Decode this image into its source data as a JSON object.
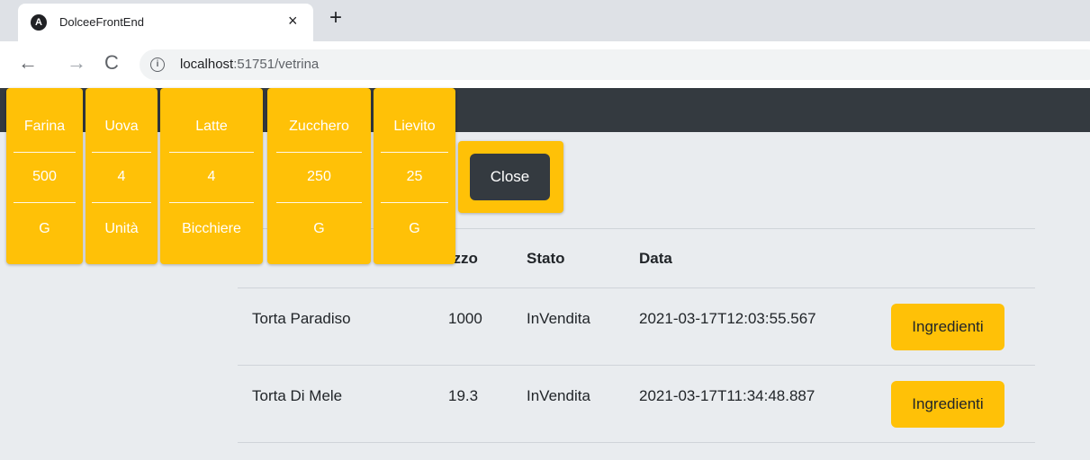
{
  "browser": {
    "tab_title": "DolceeFrontEnd",
    "tab_close": "×",
    "new_tab": "+",
    "url_host": "localhost",
    "url_path": ":51751/vetrina"
  },
  "ingredients": [
    {
      "nome": "Farina",
      "quantita": "500",
      "unita": "G"
    },
    {
      "nome": "Uova",
      "quantita": "4",
      "unita": "Unità"
    },
    {
      "nome": "Latte",
      "quantita": "4",
      "unita": "Bicchiere"
    },
    {
      "nome": "Zucchero",
      "quantita": "250",
      "unita": "G"
    },
    {
      "nome": "Lievito",
      "quantita": "25",
      "unita": "G"
    }
  ],
  "close_label": "Close",
  "table": {
    "headers": {
      "prezzo": "ezzo",
      "stato": "Stato",
      "data": "Data"
    },
    "rows": [
      {
        "nome": "Torta Paradiso",
        "prezzo": "1000",
        "stato": "InVendita",
        "data": "2021-03-17T12:03:55.567",
        "azione": "Ingredienti"
      },
      {
        "nome": "Torta Di Mele",
        "prezzo": "19.3",
        "stato": "InVendita",
        "data": "2021-03-17T11:34:48.887",
        "azione": "Ingredienti"
      }
    ]
  },
  "colors": {
    "accent": "#ffc107",
    "dark": "#343a40",
    "page_bg": "#e9ecef"
  }
}
